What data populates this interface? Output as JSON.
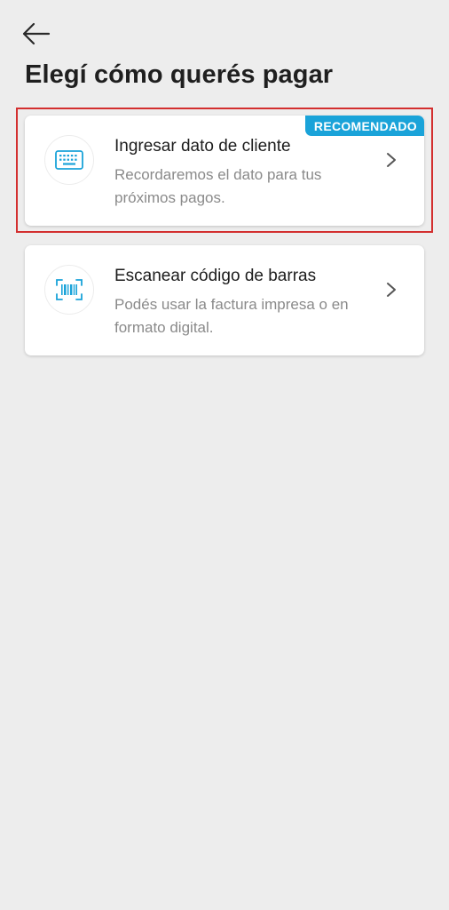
{
  "header": {
    "back_icon": "arrow-left-icon",
    "title": "Elegí cómo querés pagar"
  },
  "options": [
    {
      "title": "Ingresar dato de cliente",
      "description": "Recordaremos el dato para tus próximos pagos.",
      "badge": "RECOMENDADO",
      "icon": "keyboard-icon",
      "highlighted": true
    },
    {
      "title": "Escanear código de barras",
      "description": "Podés usar la factura impresa o en formato digital.",
      "icon": "barcode-scan-icon",
      "highlighted": false
    }
  ],
  "colors": {
    "background": "#ededed",
    "accent": "#1aa3d9",
    "highlight": "#d32f2f"
  }
}
